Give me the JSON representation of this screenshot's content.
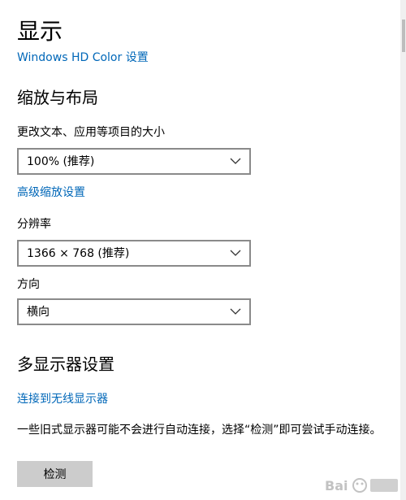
{
  "page": {
    "title": "显示",
    "hdr_link": "Windows HD Color 设置"
  },
  "scale_layout": {
    "heading": "缩放与布局",
    "text_size_label": "更改文本、应用等项目的大小",
    "scale_value": "100% (推荐)",
    "advanced_link": "高级缩放设置",
    "resolution_label": "分辨率",
    "resolution_value": "1366 × 768 (推荐)",
    "orientation_label": "方向",
    "orientation_value": "横向"
  },
  "multi_display": {
    "heading": "多显示器设置",
    "wireless_link": "连接到无线显示器",
    "description": "一些旧式显示器可能不会进行自动连接，选择“检测”即可尝试手动连接。",
    "detect_button": "检测"
  },
  "colors": {
    "accent": "#0067b8",
    "button_bg": "#cccccc"
  },
  "icons": [
    "chevron-down-icon",
    "watermark-logo"
  ]
}
